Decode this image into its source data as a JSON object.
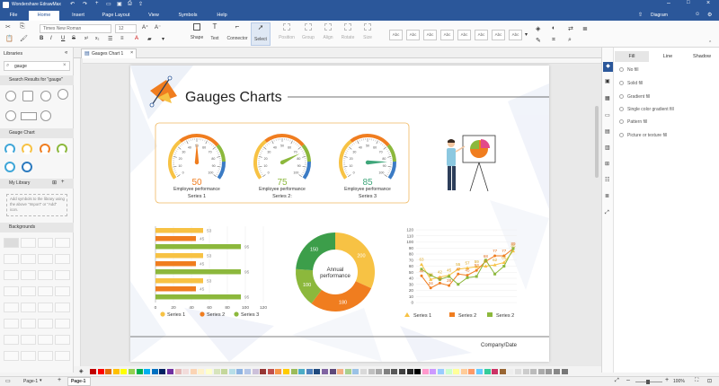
{
  "app": {
    "title": "Wondershare EdrawMax"
  },
  "menu": {
    "tabs": [
      "File",
      "Home",
      "Insert",
      "Page Layout",
      "View",
      "Symbols",
      "Help"
    ],
    "active": "Home",
    "diagram_label": "Diagram"
  },
  "ribbon": {
    "font_name": "Times New Roman",
    "font_size": "12",
    "tools": [
      "Shape",
      "Text",
      "Connector",
      "Select"
    ],
    "arrange": [
      "Position",
      "Group",
      "Align",
      "Rotate",
      "Size"
    ],
    "style_label": "Abc"
  },
  "left_panel": {
    "title": "Libraries",
    "search_value": "gauge",
    "search_results_header": "Search Results for \"gauge\"",
    "gauge_chart_header": "Gauge Chart",
    "my_library_header": "My Library",
    "my_library_hint": "Add symbols to the library using the above \"Import\" or \"Add\" icon.",
    "backgrounds_header": "Backgrounds"
  },
  "doc_tab": "Gauges Chart 1",
  "page": {
    "title": "Gauges Charts",
    "footer": "Company/Date",
    "gauges": [
      {
        "value": "50",
        "label": "Employee performance",
        "series": "Series 1",
        "color": "#f07d1f",
        "pct": 0.5
      },
      {
        "value": "75",
        "label": "Employee performance",
        "series": "Series 2:",
        "color": "#8cb83c",
        "pct": 0.75
      },
      {
        "value": "85",
        "label": "Employee performance",
        "series": "Series 3",
        "color": "#3fa67a",
        "pct": 0.85
      }
    ],
    "gauge_ticks": [
      "0",
      "10",
      "20",
      "30",
      "40",
      "50",
      "60",
      "70",
      "80",
      "90",
      "100"
    ]
  },
  "chart_data": [
    {
      "type": "bar",
      "orientation": "horizontal",
      "x_ticks": [
        "0",
        "20",
        "40",
        "60",
        "80",
        "100",
        "120"
      ],
      "xlim": [
        0,
        120
      ],
      "groups": [
        {
          "values": [
            53,
            45,
            95
          ]
        },
        {
          "values": [
            53,
            45,
            95
          ]
        },
        {
          "values": [
            53,
            45,
            95
          ]
        }
      ],
      "series": [
        {
          "name": "Series 1",
          "color": "#f7c244"
        },
        {
          "name": "Series 2",
          "color": "#f07d1f"
        },
        {
          "name": "Series 3",
          "color": "#8cb83c"
        }
      ],
      "value_labels": [
        "53",
        "45",
        "95"
      ]
    },
    {
      "type": "pie",
      "donut": true,
      "center_label": "Annual performance",
      "slices": [
        {
          "value": 200,
          "label": "200",
          "color": "#f7c244"
        },
        {
          "value": 180,
          "label": "180",
          "color": "#f07d1f"
        },
        {
          "value": 100,
          "label": "100",
          "color": "#8cb83c"
        },
        {
          "value": 150,
          "label": "150",
          "color": "#3c9e4a"
        }
      ]
    },
    {
      "type": "line",
      "y_ticks": [
        "0",
        "10",
        "20",
        "30",
        "40",
        "50",
        "60",
        "70",
        "80",
        "90",
        "100",
        "110",
        "120"
      ],
      "ylim": [
        0,
        120
      ],
      "series": [
        {
          "name": "Series 1",
          "color": "#f7c244",
          "values": [
            63,
            38,
            42,
            45,
            55,
            57,
            59,
            60,
            62,
            66,
            85
          ]
        },
        {
          "name": "Series 2",
          "color": "#f07d1f",
          "values": [
            44,
            24,
            32,
            28,
            47,
            45,
            53,
            68,
            77,
            77,
            89
          ]
        },
        {
          "name": "Series 2",
          "color": "#8cb83c",
          "values": [
            55,
            45,
            38,
            43,
            30,
            41,
            43,
            70,
            47,
            60,
            89
          ]
        }
      ],
      "point_labels": {
        "Series 1": [
          "63",
          "38",
          "42",
          "45",
          "55",
          "57",
          "59",
          "60",
          "62",
          "66",
          "85"
        ],
        "Series 2": [
          "44",
          "24",
          "32",
          "28",
          "47",
          "45",
          "53",
          "68",
          "77",
          "77",
          "89"
        ]
      }
    }
  ],
  "right_panel": {
    "tabs": [
      "Fill",
      "Line",
      "Shadow"
    ],
    "fill_options": [
      "No fill",
      "Solid fill",
      "Gradient fill",
      "Single color gradient fill",
      "Pattern fill",
      "Picture or texture fill"
    ]
  },
  "status": {
    "page_tab_1": "Page-1",
    "page_tab_2": "Page-1",
    "zoom": "100%"
  }
}
